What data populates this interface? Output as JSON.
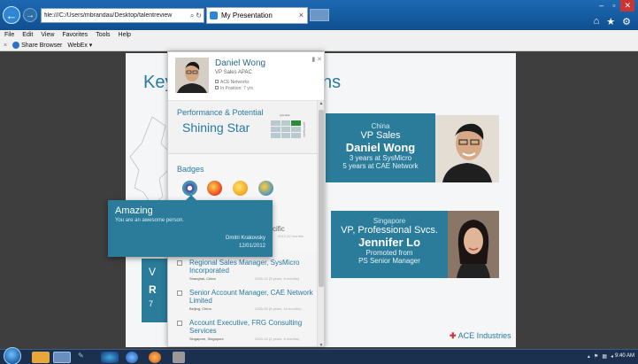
{
  "browser": {
    "address": "file:///C:/Users/mbrandau/Desktop/talentreview",
    "tab_title": "My Presentation",
    "tab_close": "×",
    "menu": [
      "File",
      "Edit",
      "View",
      "Favorites",
      "Tools",
      "Help"
    ],
    "toolbar_close": "×",
    "share_browser": "Share Browser",
    "webex": "WebEx ▾"
  },
  "slide": {
    "title_left": "Key",
    "title_right": "ns",
    "cards": [
      {
        "location": "China",
        "role": "VP Sales",
        "name": "Daniel Wong",
        "line1": "3 years at SysMicro",
        "line2": "5 years at CAE Network"
      },
      {
        "location": "Singapore",
        "role": "VP, Professional Svcs.",
        "name": "Jennifer Lo",
        "line1": "Promoted from",
        "line2": "PS Senior Manager"
      }
    ],
    "left_card_frag1": "V",
    "left_card_frag2": "R",
    "left_card_frag3": "7",
    "logo_mark": "✚",
    "logo_text": "ACE Industries"
  },
  "panel": {
    "name": "Daniel Wong",
    "title": "VP Sales APAC",
    "meta1": "ACE Networks",
    "meta2": "In Position: 7 yrs",
    "perf_label": "Performance & Potential",
    "perf_value": "Shining Star",
    "axis_top": "potential",
    "axis_side": "performance",
    "badges_label": "Badges",
    "fragment_text": "cific",
    "fragment_dim": "2012-12 months",
    "positions": [
      {
        "name": "Regional Sales Manager, SysMicro Incorporated",
        "location": "Shanghai, China",
        "duration": "2005-12 (3 years, 8 months)"
      },
      {
        "name": "Senior Account Manager, CAE Network Limited",
        "location": "Beijing, China",
        "duration": "2005-05 (6 years, 10 months)"
      },
      {
        "name": "Account Executive, FRG Consulting Services",
        "location": "Singapore, Singapore",
        "duration": "2000-12 (2 years, 8 months)"
      }
    ]
  },
  "tooltip": {
    "title": "Amazing",
    "body": "You are an awesome person.",
    "author": "Dmitri Krakovsky",
    "date": "12/01/2012"
  },
  "taskbar": {
    "clock": "9:40 AM"
  },
  "colors": {
    "accent": "#2a7c9a",
    "title_blue": "#2a7aa0",
    "page_bg": "#3e3e3e"
  }
}
